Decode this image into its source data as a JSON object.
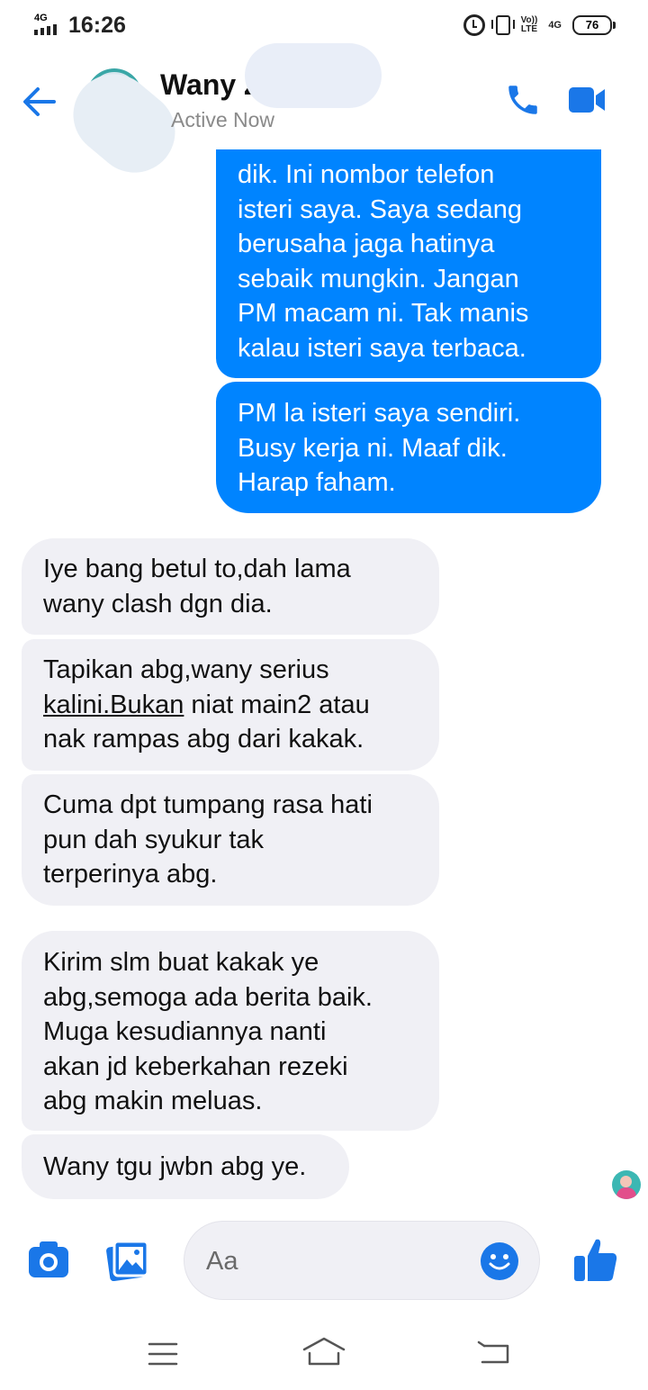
{
  "status_bar": {
    "network": "4G",
    "time": "16:26",
    "volte_top": "Vo))",
    "volte_bottom": "LTE",
    "signal_type": "4G",
    "battery": "76"
  },
  "header": {
    "contact_name": "Wany Z",
    "presence": "Active Now",
    "icons": {
      "back": "arrow-left-icon",
      "call": "phone-icon",
      "video": "video-camera-icon"
    }
  },
  "colors": {
    "accent": "#0084ff",
    "icon_blue": "#1a77e8",
    "incoming_bg": "#f0f0f5"
  },
  "messages": [
    {
      "direction": "out",
      "lines": [
        "dik. Ini nombor telefon",
        "isteri saya. Saya sedang",
        "berusaha jaga hatinya",
        "sebaik mungkin. Jangan",
        "PM macam ni. Tak manis",
        "kalau isteri saya terbaca."
      ]
    },
    {
      "direction": "out",
      "lines": [
        "PM la isteri saya sendiri.",
        "Busy kerja ni. Maaf dik.",
        "Harap faham."
      ]
    },
    {
      "direction": "in",
      "lines": [
        "Iye bang betul to,dah lama",
        "wany clash dgn dia."
      ]
    },
    {
      "direction": "in",
      "lines": [
        "Tapikan abg,wany serius"
      ],
      "link_text": "kalini.Bukan",
      "line2_rest": " niat main2 atau",
      "lines_after": [
        "nak rampas abg dari kakak."
      ]
    },
    {
      "direction": "in",
      "lines": [
        "Cuma dpt tumpang rasa hati",
        "pun dah syukur tak",
        "terperinya abg."
      ]
    },
    {
      "direction": "in",
      "lines": [
        "Kirim slm buat kakak ye",
        "abg,semoga ada berita baik.",
        "Muga kesudiannya nanti",
        "akan jd keberkahan rezeki",
        "abg makin meluas."
      ]
    },
    {
      "direction": "in",
      "lines": [
        "Wany tgu jwbn abg ye."
      ]
    }
  ],
  "composer": {
    "placeholder": "Aa",
    "icons": {
      "camera": "camera-icon",
      "gallery": "gallery-icon",
      "emoji": "emoji-icon",
      "like": "thumbs-up-icon"
    }
  },
  "nav_bar": {
    "icons": [
      "menu-icon",
      "home-icon",
      "back-icon"
    ]
  }
}
